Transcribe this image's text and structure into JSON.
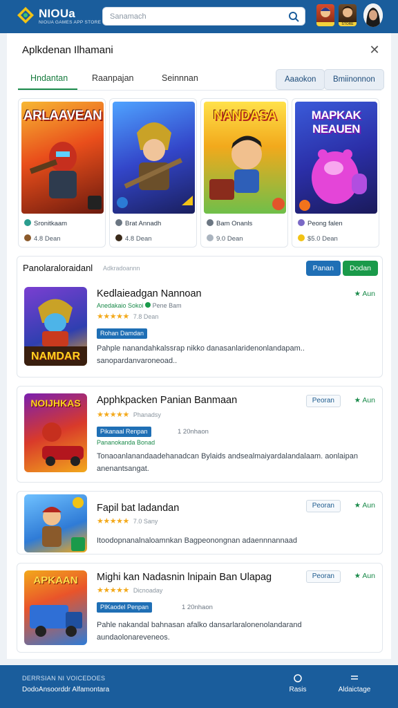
{
  "header": {
    "brand": "NIOUa",
    "brand_sub": "NIOUA GAMES APP STORE",
    "search_placeholder": "Sanamach",
    "avatars": [
      "hero-avatar",
      "warrior-avatar"
    ],
    "avatar_caption": "STORE"
  },
  "panel": {
    "title": "Aplkdenan Ilhamani",
    "tabs": [
      "Hndantan",
      "Raanpajan",
      "Seinnnan"
    ],
    "active_tab": 0,
    "buttons": [
      "Aaaokon",
      "Bmiinonnon"
    ]
  },
  "featured": [
    {
      "art_title": "ARLAAVEAN",
      "developer": "Sronitkaam",
      "meta": "4.8 Dean",
      "accent": "#e6452a"
    },
    {
      "art_title": "",
      "developer": "Brat Annadh",
      "meta": "4.8 Dean",
      "accent": "#2f5fd6"
    },
    {
      "art_title": "NANDASA",
      "developer": "Bam Onanls",
      "meta": "9.0 Dean",
      "accent": "#f4c20d"
    },
    {
      "art_title": "MAPKAK NEAUEN",
      "developer": "Peong falen",
      "meta": "$5.0 Dean",
      "accent": "#2b46c9"
    }
  ],
  "section": {
    "title": "Panolaraloraidanl",
    "subtitle": "Adkradoannn",
    "btn_primary": "Panan",
    "btn_secondary": "Dodan"
  },
  "apps": [
    {
      "name": "Kedlaieadgan Nannoan",
      "developer": "Anedakaio Sokoi",
      "dev_note": "Pene Bam",
      "stars": "★★★★★",
      "star_meta": "7.8 Dean",
      "badge": "Rohan Damdan",
      "badge_note": "",
      "desc": "Pahple nanandahkalssrap nikko danasanlaridenonlandapam.. sanopardanvaroneoad..",
      "tag": "",
      "rating": "★ Aun",
      "art_title": "NAMDAR"
    },
    {
      "name": "Apphkpacken Panian Banmaan",
      "developer": "",
      "dev_note": "",
      "stars": "★★★★★",
      "star_meta": "Phanadsy",
      "badge": "Pikanaal Renpan",
      "badge_note": "1 20nhaon",
      "green_dev": "Pananokanda Bonad",
      "desc": "Tonaoanlanandaadehanadcan Bylaids andsealmaiyardalandalaam. aonlaipan anenantsangat.",
      "tag": "Peoran",
      "rating": "★ Aun",
      "art_title": "NOIJHKAS"
    },
    {
      "name": "Fapil bat ladandan",
      "developer": "",
      "dev_note": "",
      "stars": "★★★★★",
      "star_meta": "7.0 Sany",
      "badge": "",
      "badge_note": "",
      "desc": "Itoodopnanalnaloamnkan Bagpeonongnan adaennnannaad",
      "tag": "Peoran",
      "rating": "★ Aun",
      "art_title": ""
    },
    {
      "name": "Mighi kan Nadasnin lnipain Ban Ulapag",
      "developer": "",
      "dev_note": "",
      "stars": "★★★★★",
      "star_meta": "Dicnoaday",
      "badge": "PIKaodel Penpan",
      "badge_note": "1 20nhaon",
      "desc": "Pahle nakandal bahnasan afalko dansarlaralonenolandarand aundaolonareveneos.",
      "tag": "Peoran",
      "rating": "★ Aun",
      "art_title": "APKAAN"
    }
  ],
  "footer": {
    "line1": "DERRSIAN NI VOICEDOES",
    "line2": "DodoAnsoorddr Alfamontara",
    "nav": [
      "Rasis",
      "Aldaictage"
    ]
  },
  "colors": {
    "primary": "#1a5d9c",
    "accent_green": "#1a8a4a",
    "star": "#f3a91b"
  }
}
